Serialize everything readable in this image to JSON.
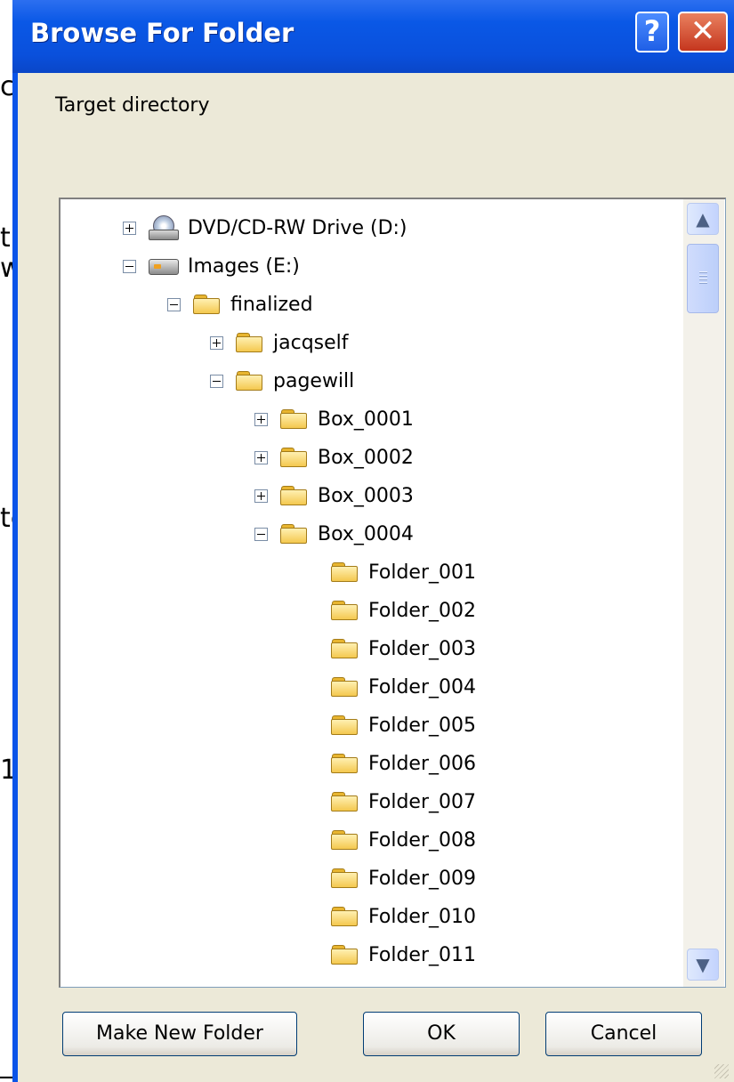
{
  "background_fragments": [
    "ca",
    "t",
    "w",
    "te",
    "1",
    "_"
  ],
  "dialog": {
    "title": "Browse For Folder",
    "help_label": "?",
    "close_label": "✕",
    "prompt": "Target directory"
  },
  "tree": {
    "nodes": [
      {
        "label": "DVD/CD-RW Drive (D:)",
        "icon": "cd-drive-icon",
        "expander": "plus"
      },
      {
        "label": "Images (E:)",
        "icon": "hard-drive-icon",
        "expander": "minus"
      },
      {
        "label": "finalized",
        "icon": "folder-icon",
        "expander": "minus"
      },
      {
        "label": "jacqself",
        "icon": "folder-icon",
        "expander": "plus"
      },
      {
        "label": "pagewill",
        "icon": "folder-icon",
        "expander": "minus"
      },
      {
        "label": "Box_0001",
        "icon": "folder-icon",
        "expander": "plus"
      },
      {
        "label": "Box_0002",
        "icon": "folder-icon",
        "expander": "plus"
      },
      {
        "label": "Box_0003",
        "icon": "folder-icon",
        "expander": "plus"
      },
      {
        "label": "Box_0004",
        "icon": "folder-icon",
        "expander": "minus"
      },
      {
        "label": "Folder_001",
        "icon": "folder-icon",
        "expander": "none"
      },
      {
        "label": "Folder_002",
        "icon": "folder-icon",
        "expander": "none"
      },
      {
        "label": "Folder_003",
        "icon": "folder-icon",
        "expander": "none"
      },
      {
        "label": "Folder_004",
        "icon": "folder-icon",
        "expander": "none"
      },
      {
        "label": "Folder_005",
        "icon": "folder-icon",
        "expander": "none"
      },
      {
        "label": "Folder_006",
        "icon": "folder-icon",
        "expander": "none"
      },
      {
        "label": "Folder_007",
        "icon": "folder-icon",
        "expander": "none"
      },
      {
        "label": "Folder_008",
        "icon": "folder-icon",
        "expander": "none"
      },
      {
        "label": "Folder_009",
        "icon": "folder-icon",
        "expander": "none"
      },
      {
        "label": "Folder_010",
        "icon": "folder-icon",
        "expander": "none"
      },
      {
        "label": "Folder_011",
        "icon": "folder-icon",
        "expander": "none"
      }
    ],
    "scroll_up": "▲",
    "scroll_down": "▼"
  },
  "buttons": {
    "make_new_folder": "Make New Folder",
    "ok": "OK",
    "cancel": "Cancel"
  },
  "colors": {
    "titlebar": "#0a54e8",
    "client": "#ece9d8",
    "close": "#c5361e"
  }
}
